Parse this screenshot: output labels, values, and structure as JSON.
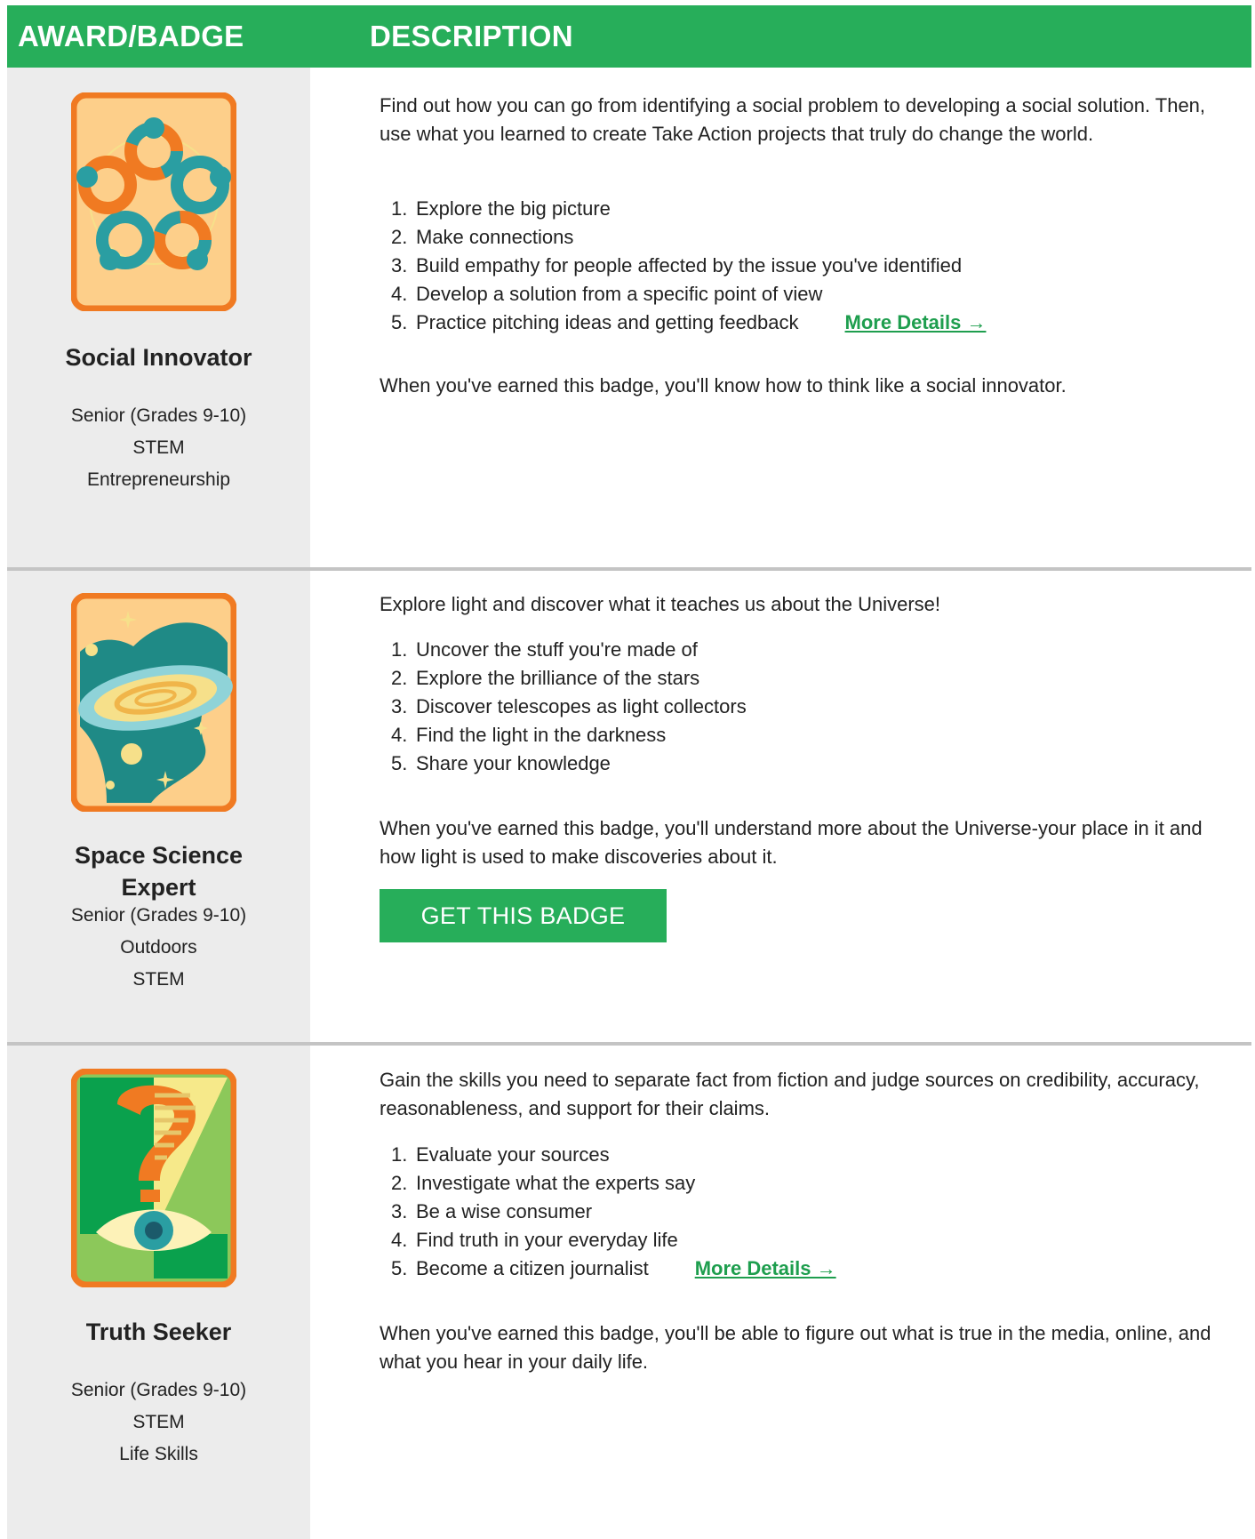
{
  "header": {
    "col_award": "AWARD/BADGE",
    "col_description": "DESCRIPTION"
  },
  "badges": [
    {
      "icon": "social-innovator-badge-icon",
      "name": "Social Innovator",
      "meta": [
        "Senior (Grades 9-10)",
        "STEM",
        "Entrepreneurship"
      ],
      "intro": "Find out how you can go from identifying a social problem to developing a social solution. Then, use what you learned to create Take Action projects that truly do change the world.",
      "steps": [
        {
          "num": "1.",
          "text": "Explore the big picture"
        },
        {
          "num": "2.",
          "text": "Make connections"
        },
        {
          "num": "3.",
          "text": "Build empathy for people affected by the issue you've identified"
        },
        {
          "num": "4.",
          "text": "Develop a solution from a specific point of view"
        },
        {
          "num": "5.",
          "text": "Practice pitching ideas and getting feedback"
        }
      ],
      "more_link": "More Details →",
      "outro": "When you've earned this badge, you'll know how to think like a social innovator."
    },
    {
      "icon": "space-science-badge-icon",
      "name_line1": "Space Science",
      "name_line2": "Expert",
      "meta": [
        "Senior (Grades 9-10)",
        "Outdoors",
        "STEM"
      ],
      "intro": "Explore light and discover what it teaches us about the Universe!",
      "steps": [
        {
          "num": "1.",
          "text": "Uncover the stuff you're made of"
        },
        {
          "num": "2.",
          "text": "Explore the brilliance of the stars"
        },
        {
          "num": "3.",
          "text": "Discover telescopes as light collectors"
        },
        {
          "num": "4.",
          "text": "Find the light in the darkness"
        },
        {
          "num": "5.",
          "text": "Share your knowledge"
        }
      ],
      "outro": "When you've earned this badge, you'll understand more about the Universe-your place in it and how light is used to make discoveries about it.",
      "cta": "GET THIS BADGE"
    },
    {
      "icon": "truth-seeker-badge-icon",
      "name": "Truth Seeker",
      "meta": [
        "Senior (Grades 9-10)",
        "STEM",
        "Life Skills"
      ],
      "intro": "Gain the skills you need to separate fact from fiction and judge sources on credibility, accuracy, reasonableness, and support for their claims.",
      "steps": [
        {
          "num": "1.",
          "text": "Evaluate your sources"
        },
        {
          "num": "2.",
          "text": "Investigate what the experts say"
        },
        {
          "num": "3.",
          "text": "Be a wise consumer"
        },
        {
          "num": "4.",
          "text": "Find truth in your everyday life"
        },
        {
          "num": "5.",
          "text": "Become a citizen journalist"
        }
      ],
      "more_link": "More Details →",
      "outro": "When you've earned this badge, you'll be able to figure out what is true in the media, online, and what you hear in your daily life."
    }
  ],
  "colors": {
    "brand_green": "#27ae5a",
    "link_green": "#1e9e4e",
    "panel_gray": "#ececec",
    "badge_orange": "#f07a22",
    "badge_cream": "#fdcf8a",
    "badge_teal": "#2a9ea2"
  }
}
